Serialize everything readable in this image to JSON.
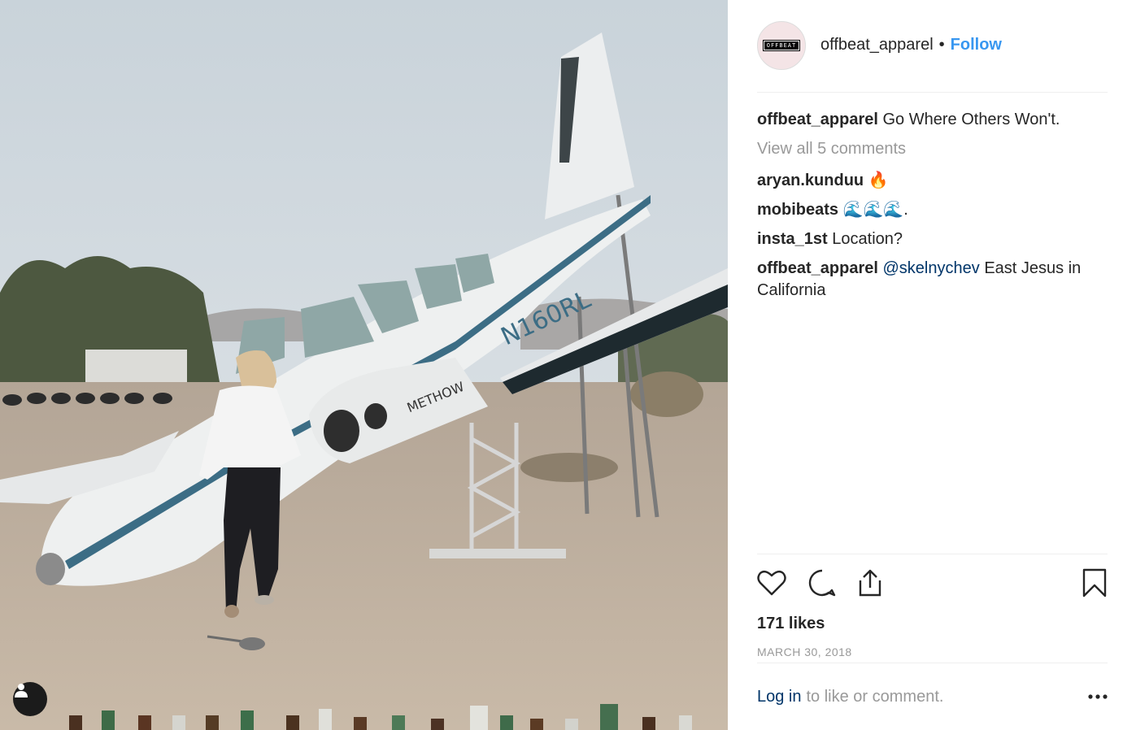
{
  "post": {
    "author": "offbeat_apparel",
    "avatar_text": "OFFBEAT",
    "separator": "•",
    "follow_label": "Follow"
  },
  "caption": {
    "user": "offbeat_apparel",
    "text": "Go Where Others Won't."
  },
  "view_all_comments": "View all 5 comments",
  "comments": [
    {
      "user": "aryan.kunduu",
      "text": "🔥"
    },
    {
      "user": "mobibeats",
      "text": "🌊🌊🌊."
    },
    {
      "user": "insta_1st",
      "text": "Location?"
    },
    {
      "user": "offbeat_apparel",
      "mention": "@skelnychev",
      "text": "East Jesus in California"
    }
  ],
  "likes": "171 likes",
  "date": "MARCH 30, 2018",
  "login": {
    "link": "Log in",
    "rest": "to like or comment."
  },
  "photo_text": {
    "tail_number": "N160RL",
    "engine_text": "METHOW"
  },
  "colors": {
    "link_blue": "#3897f0",
    "mention_blue": "#003569",
    "muted": "#999999"
  },
  "icons": [
    "heart-icon",
    "comment-icon",
    "share-icon",
    "bookmark-icon",
    "more-icon",
    "user-tag-icon"
  ]
}
